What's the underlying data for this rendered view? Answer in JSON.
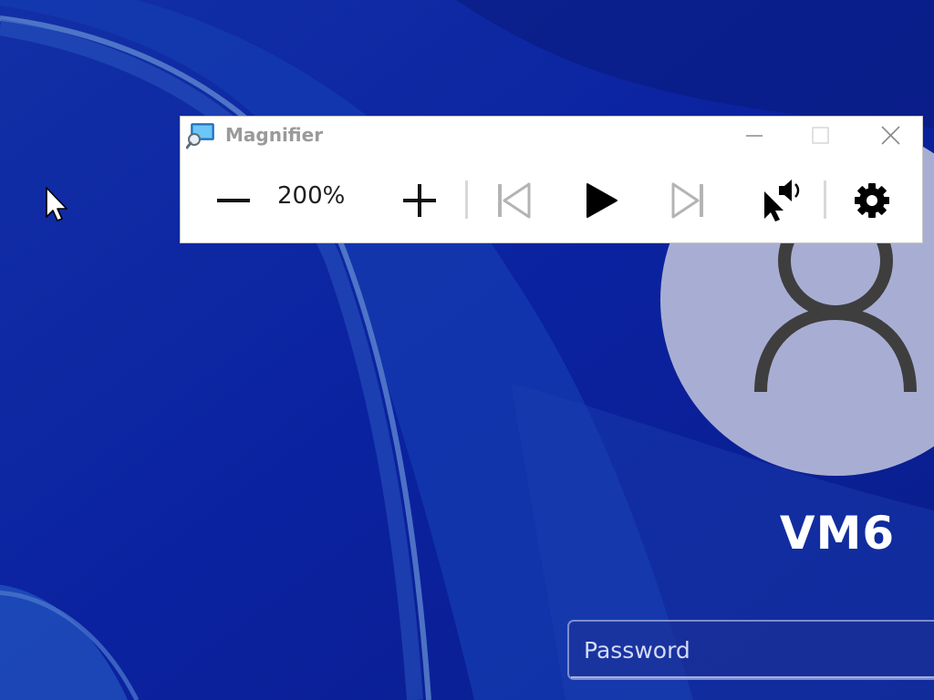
{
  "window": {
    "title": "Magnifier",
    "icon": "magnifier-app-icon",
    "caption_buttons": [
      "minimize-icon",
      "maximize-icon",
      "close-icon"
    ]
  },
  "toolbar": {
    "zoom_out_icon": "minus-icon",
    "zoom_level": "200%",
    "zoom_in_icon": "plus-icon",
    "prev_icon": "skip-previous-icon",
    "play_icon": "play-icon",
    "next_icon": "skip-next-icon",
    "read_from_here_icon": "read-from-here-icon",
    "settings_icon": "gear-icon"
  },
  "lock_screen": {
    "user_name": "VM6",
    "password_placeholder": "Password",
    "avatar_icon": "user-silhouette-icon"
  },
  "colors": {
    "desktop_background": "#0a1f8c",
    "avatar_background": "#a8aed3",
    "avatar_silhouette": "#3e3e3e",
    "window_background": "#ffffff",
    "title_text": "#9a9a9a",
    "disabled_icon": "#b4b4b4",
    "active_icon": "#000000"
  }
}
